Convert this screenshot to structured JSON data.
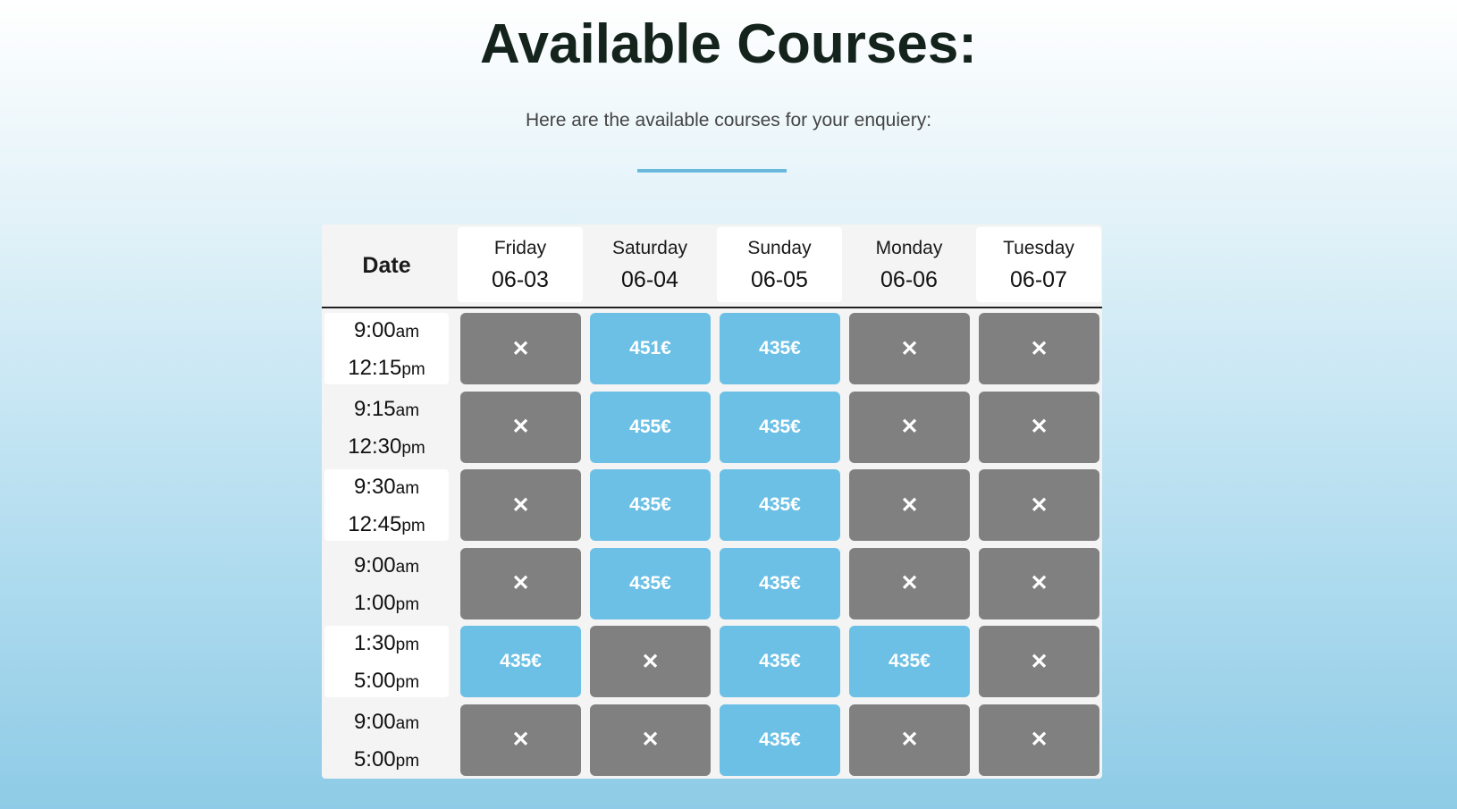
{
  "title": "Available Courses:",
  "subtitle": "Here are the available courses for your enquiery:",
  "table": {
    "date_label": "Date",
    "columns": [
      {
        "day": "Friday",
        "date": "06-03"
      },
      {
        "day": "Saturday",
        "date": "06-04"
      },
      {
        "day": "Sunday",
        "date": "06-05"
      },
      {
        "day": "Monday",
        "date": "06-06"
      },
      {
        "day": "Tuesday",
        "date": "06-07"
      }
    ],
    "rows": [
      {
        "start": "9:00",
        "start_suffix": "am",
        "end": "12:15",
        "end_suffix": "pm",
        "cells": [
          "✕",
          "451€",
          "435€",
          "✕",
          "✕"
        ]
      },
      {
        "start": "9:15",
        "start_suffix": "am",
        "end": "12:30",
        "end_suffix": "pm",
        "cells": [
          "✕",
          "455€",
          "435€",
          "✕",
          "✕"
        ]
      },
      {
        "start": "9:30",
        "start_suffix": "am",
        "end": "12:45",
        "end_suffix": "pm",
        "cells": [
          "✕",
          "435€",
          "435€",
          "✕",
          "✕"
        ]
      },
      {
        "start": "9:00",
        "start_suffix": "am",
        "end": "1:00",
        "end_suffix": "pm",
        "cells": [
          "✕",
          "435€",
          "435€",
          "✕",
          "✕"
        ]
      },
      {
        "start": "1:30",
        "start_suffix": "pm",
        "end": "5:00",
        "end_suffix": "pm",
        "cells": [
          "435€",
          "✕",
          "435€",
          "435€",
          "✕"
        ]
      },
      {
        "start": "9:00",
        "start_suffix": "am",
        "end": "5:00",
        "end_suffix": "pm",
        "cells": [
          "✕",
          "✕",
          "435€",
          "✕",
          "✕"
        ]
      }
    ]
  },
  "colors": {
    "available": "#6cc0e5",
    "unavailable": "#808080",
    "accent": "#6ab8dc"
  }
}
